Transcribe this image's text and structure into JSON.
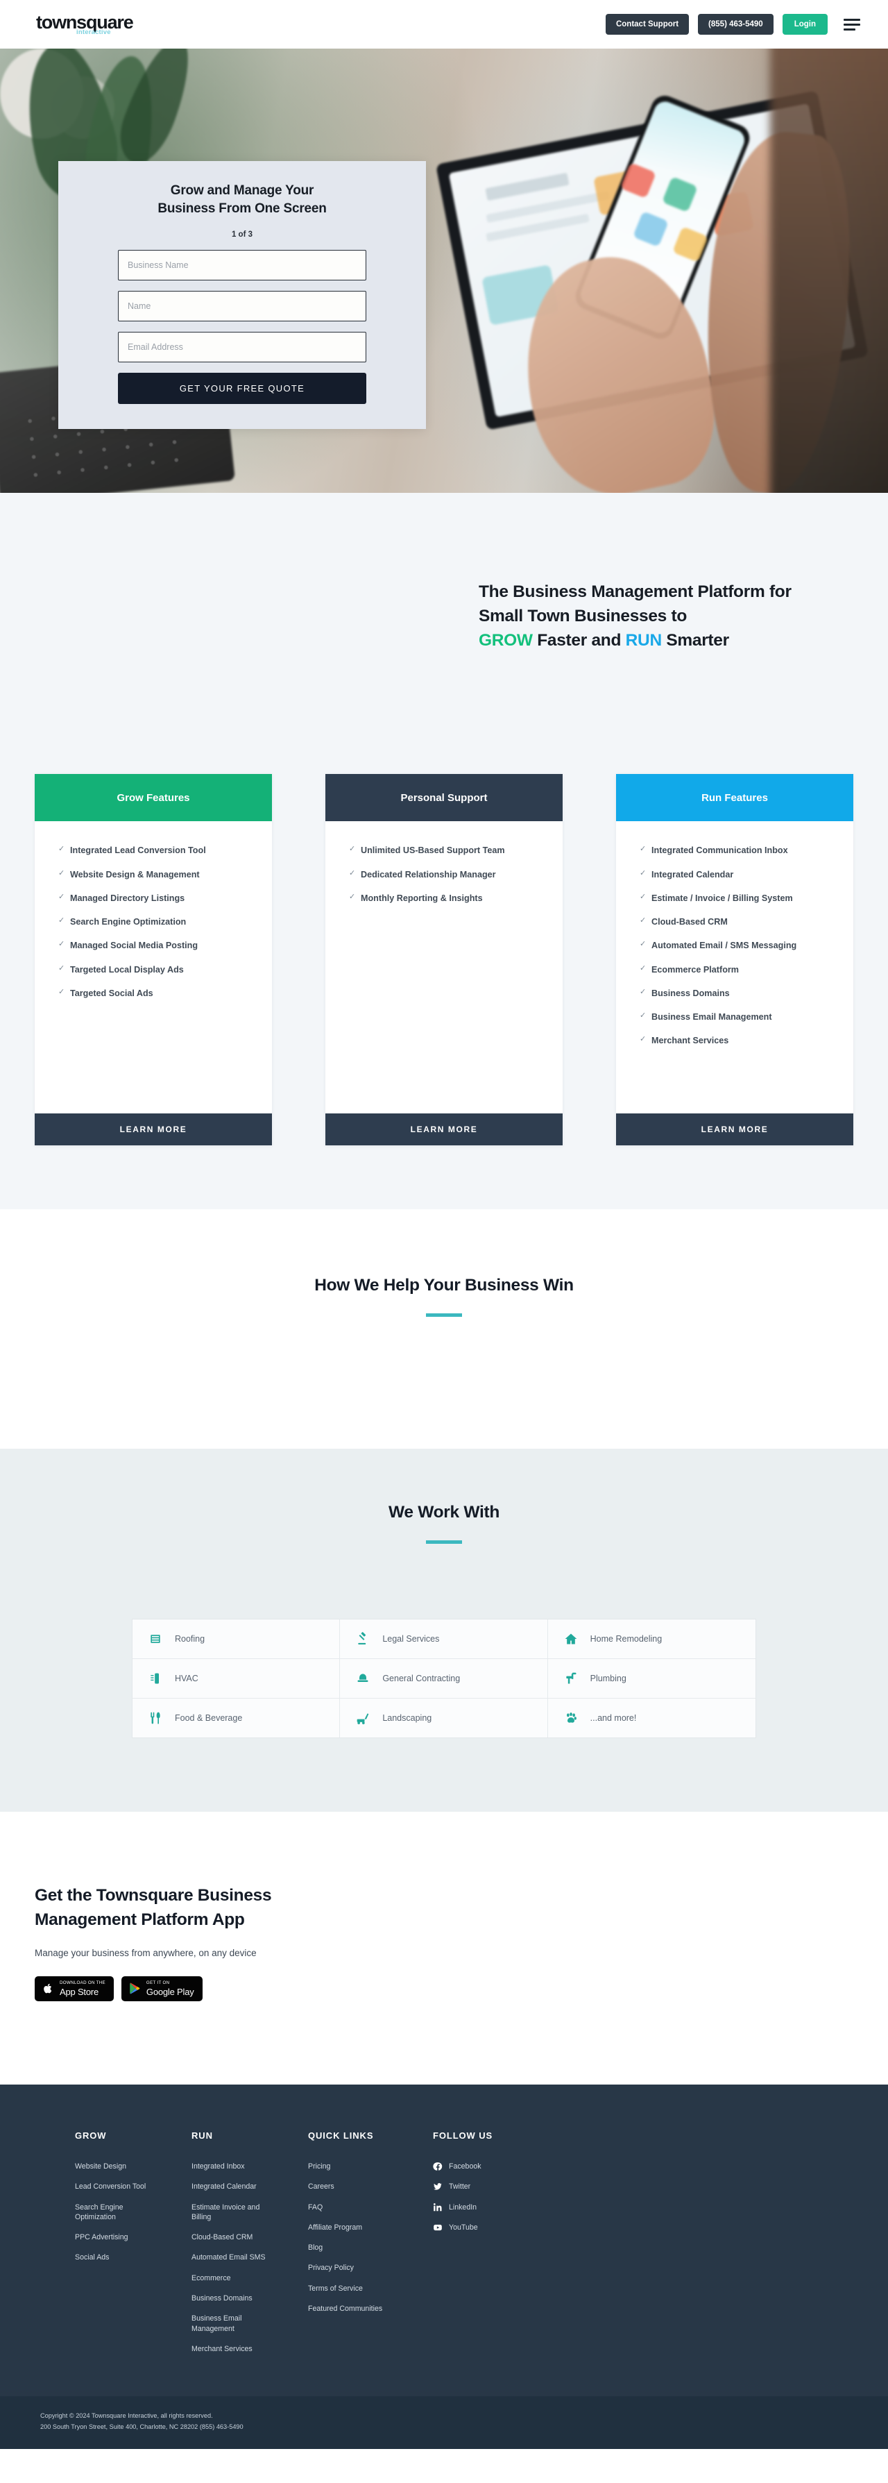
{
  "header": {
    "logo_main": "townsquare",
    "logo_sub": "interactive",
    "contact_support": "Contact Support",
    "phone": "(855) 463-5490",
    "login": "Login"
  },
  "hero": {
    "title_line1": "Grow and Manage Your",
    "title_line2": "Business From One Screen",
    "step": "1 of 3",
    "fields": [
      {
        "name": "business-name",
        "placeholder": "Business Name",
        "value": ""
      },
      {
        "name": "name",
        "placeholder": "Name",
        "value": ""
      },
      {
        "name": "email",
        "placeholder": "Email Address",
        "value": ""
      }
    ],
    "submit": "GET YOUR FREE QUOTE"
  },
  "platform": {
    "heading_line1": "The Business Management Platform for",
    "heading_line2": "Small Town Businesses to",
    "kw_grow": "GROW",
    "mid_text": " Faster and ",
    "kw_run": "RUN",
    "end_text": " Smarter"
  },
  "cards": [
    {
      "title": "Grow Features",
      "color": "#14b177",
      "cta": "LEARN MORE",
      "items": [
        "Integrated Lead Conversion Tool",
        "Website Design & Management",
        "Managed Directory Listings",
        "Search Engine Optimization",
        "Managed Social Media Posting",
        "Targeted Local Display Ads",
        "Targeted Social Ads"
      ]
    },
    {
      "title": "Personal Support",
      "color": "#2e3d4f",
      "cta": "LEARN MORE",
      "items": [
        "Unlimited US-Based Support Team",
        "Dedicated Relationship Manager",
        "Monthly Reporting & Insights"
      ]
    },
    {
      "title": "Run Features",
      "color": "#11a9e9",
      "cta": "LEARN MORE",
      "items": [
        "Integrated Communication Inbox",
        "Integrated Calendar",
        "Estimate / Invoice / Billing System",
        "Cloud-Based CRM",
        "Automated Email / SMS Messaging",
        "Ecommerce Platform",
        "Business Domains",
        "Business Email Management",
        "Merchant Services"
      ]
    }
  ],
  "how_we_help": {
    "title": "How We Help Your Business Win"
  },
  "work_with": {
    "title": "We Work With",
    "items": [
      {
        "label": "Roofing",
        "icon": "roofing-icon"
      },
      {
        "label": "Legal Services",
        "icon": "gavel-icon"
      },
      {
        "label": "Home Remodeling",
        "icon": "house-icon"
      },
      {
        "label": "HVAC",
        "icon": "hvac-icon"
      },
      {
        "label": "General Contracting",
        "icon": "hardhat-icon"
      },
      {
        "label": "Plumbing",
        "icon": "faucet-icon"
      },
      {
        "label": "Food & Beverage",
        "icon": "utensils-icon"
      },
      {
        "label": "Landscaping",
        "icon": "mower-icon"
      },
      {
        "label": "...and more!",
        "icon": "paw-icon"
      }
    ]
  },
  "app": {
    "heading_line1": "Get the Townsquare Business",
    "heading_line2": "Management Platform App",
    "subtitle": "Manage your business from anywhere, on any device",
    "app_store": {
      "small": "Download on the",
      "big": "App Store",
      "icon": "apple-icon"
    },
    "google_play": {
      "small": "GET IT ON",
      "big": "Google Play",
      "icon": "google-play-icon"
    }
  },
  "footer": {
    "columns": [
      {
        "title": "GROW",
        "links": [
          "Website Design",
          "Lead Conversion Tool",
          "Search Engine Optimization",
          "PPC Advertising",
          "Social Ads"
        ]
      },
      {
        "title": "RUN",
        "links": [
          "Integrated Inbox",
          "Integrated Calendar",
          "Estimate Invoice and Billing",
          "Cloud-Based CRM",
          "Automated Email SMS",
          "Ecommerce",
          "Business Domains",
          "Business Email Management",
          "Merchant Services"
        ]
      },
      {
        "title": "QUICK LINKS",
        "links": [
          "Pricing",
          "Careers",
          "FAQ",
          "Affiliate Program",
          "Blog",
          "Privacy Policy",
          "Terms of Service",
          "Featured Communities"
        ]
      }
    ],
    "follow": {
      "title": "FOLLOW US",
      "links": [
        {
          "label": "Facebook",
          "icon": "facebook-icon"
        },
        {
          "label": "Twitter",
          "icon": "twitter-icon"
        },
        {
          "label": "LinkedIn",
          "icon": "linkedin-icon"
        },
        {
          "label": "YouTube",
          "icon": "youtube-icon"
        }
      ]
    },
    "copyright_line1": "Copyright © 2024 Townsquare Interactive, all rights reserved.",
    "copyright_line2": "200 South Tryon Street, Suite 400, Charlotte, NC 28202   (855) 463-5490"
  },
  "colors": {
    "grow_green": "#13c07c",
    "run_blue": "#19a8e8",
    "login_green": "#1cb98c",
    "dark_navy": "#2e3d4f",
    "teal_rule": "#3bb8bf",
    "footer_bg": "#283747"
  }
}
